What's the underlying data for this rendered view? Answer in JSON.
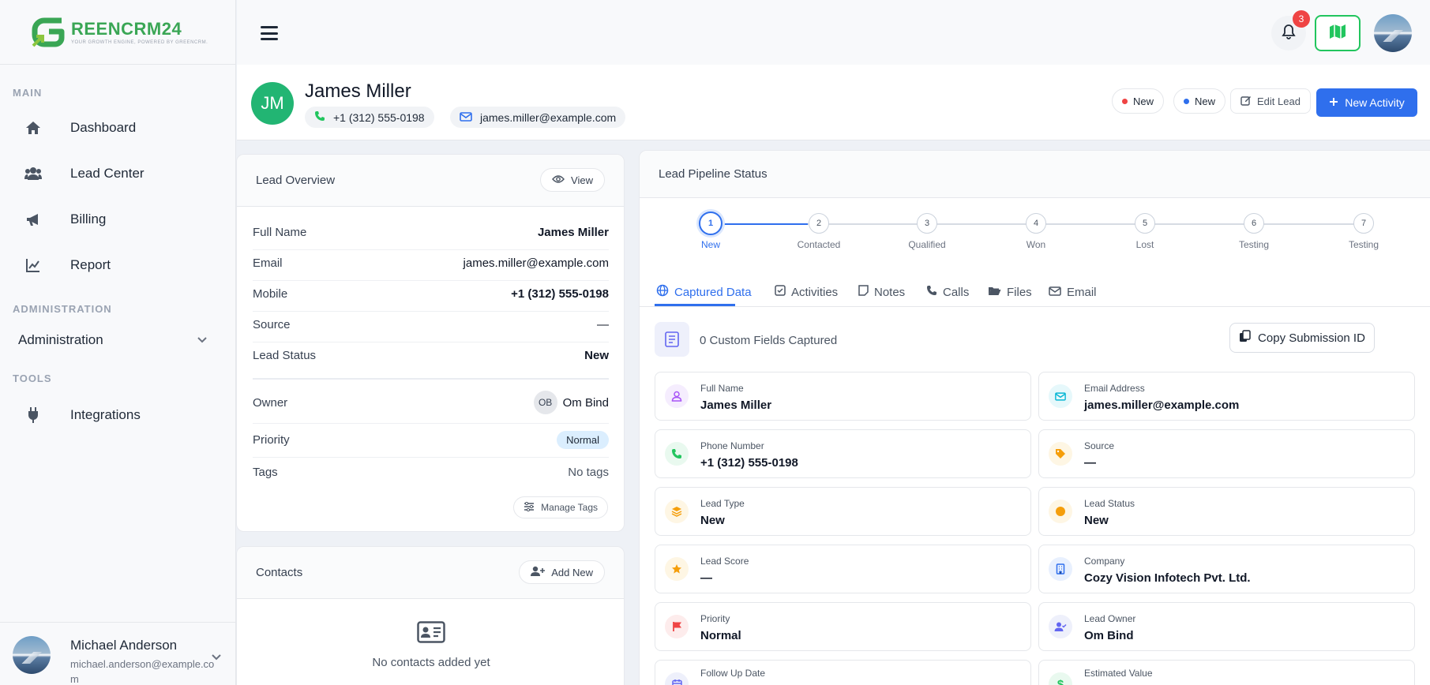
{
  "brand": {
    "name": "REENCRM24",
    "tagline": "YOUR GROWTH ENGINE, POWERED BY GREENCRM."
  },
  "sidebar": {
    "sections": {
      "main": "MAIN",
      "administration": "ADMINISTRATION",
      "tools": "TOOLS"
    },
    "items": [
      {
        "label": "Dashboard"
      },
      {
        "label": "Lead Center"
      },
      {
        "label": "Billing"
      },
      {
        "label": "Report"
      }
    ],
    "administration_label": "Administration",
    "tools_items": [
      {
        "label": "Integrations"
      }
    ],
    "user": {
      "name": "Michael Anderson",
      "email": "michael.anderson@example.com"
    }
  },
  "topbar": {
    "notification_count": "3"
  },
  "lead": {
    "initials": "JM",
    "name": "James Miller",
    "phone": "+1 (312) 555-0198",
    "email": "james.miller@example.com",
    "status_pill_1": "New",
    "status_pill_2": "New",
    "edit_label": "Edit Lead",
    "new_activity_label": "New Activity"
  },
  "overview": {
    "title": "Lead Overview",
    "view_label": "View",
    "rows": [
      {
        "label": "Full Name",
        "value": "James Miller"
      },
      {
        "label": "Email",
        "value": "james.miller@example.com"
      },
      {
        "label": "Mobile",
        "value": "+1 (312) 555-0198"
      },
      {
        "label": "Source",
        "value": "—"
      },
      {
        "label": "Lead Status",
        "value": "New"
      }
    ],
    "owner_label": "Owner",
    "owner_initials": "OB",
    "owner_name": "Om Bind",
    "priority_label": "Priority",
    "priority_value": "Normal",
    "tags_label": "Tags",
    "tags_value": "No tags",
    "manage_tags_label": "Manage Tags"
  },
  "contacts": {
    "title": "Contacts",
    "add_label": "Add New",
    "empty_text": "No contacts added yet"
  },
  "pipeline": {
    "title": "Lead Pipeline Status",
    "steps": [
      {
        "num": "1",
        "label": "New"
      },
      {
        "num": "2",
        "label": "Contacted"
      },
      {
        "num": "3",
        "label": "Qualified"
      },
      {
        "num": "4",
        "label": "Won"
      },
      {
        "num": "5",
        "label": "Lost"
      },
      {
        "num": "6",
        "label": "Testing"
      },
      {
        "num": "7",
        "label": "Testing"
      }
    ],
    "tabs": [
      {
        "label": "Captured Data"
      },
      {
        "label": "Activities"
      },
      {
        "label": "Notes"
      },
      {
        "label": "Calls"
      },
      {
        "label": "Files"
      },
      {
        "label": "Email"
      }
    ],
    "custom_fields_text": "0 Custom Fields Captured",
    "copy_label": "Copy Submission ID",
    "fields": [
      {
        "label": "Full Name",
        "value": "James Miller",
        "icon": "user-icon",
        "color": "#a855f7"
      },
      {
        "label": "Email Address",
        "value": "james.miller@example.com",
        "icon": "envelope-icon",
        "color": "#06b6d4"
      },
      {
        "label": "Phone Number",
        "value": "+1 (312) 555-0198",
        "icon": "phone-icon",
        "color": "#22c55e"
      },
      {
        "label": "Source",
        "value": "—",
        "icon": "tag-icon",
        "color": "#f59e0b"
      },
      {
        "label": "Lead Type",
        "value": "New",
        "icon": "layers-icon",
        "color": "#f59e0b"
      },
      {
        "label": "Lead Status",
        "value": "New",
        "icon": "circle-icon",
        "color": "#f59e0b"
      },
      {
        "label": "Lead Score",
        "value": "—",
        "icon": "star-icon",
        "color": "#f59e0b"
      },
      {
        "label": "Company",
        "value": "Cozy Vision Infotech Pvt. Ltd.",
        "icon": "building-icon",
        "color": "#2f6fed"
      },
      {
        "label": "Priority",
        "value": "Normal",
        "icon": "flag-icon",
        "color": "#ef4444"
      },
      {
        "label": "Lead Owner",
        "value": "Om Bind",
        "icon": "user-check-icon",
        "color": "#6366f1"
      },
      {
        "label": "Follow Up Date",
        "value": "",
        "icon": "calendar-icon",
        "color": "#6366f1"
      },
      {
        "label": "Estimated Value",
        "value": "",
        "icon": "dollar-icon",
        "color": "#22c55e"
      }
    ]
  }
}
